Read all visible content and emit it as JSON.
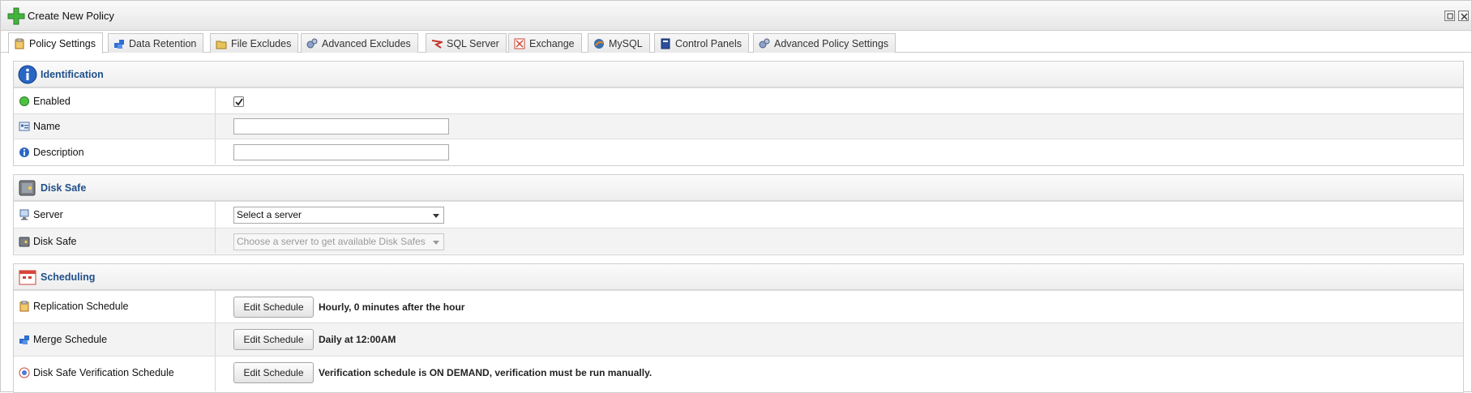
{
  "window": {
    "title": "Create New Policy",
    "maximize_icon": "maximize-icon",
    "close_icon": "close-icon"
  },
  "tabs": [
    {
      "label": "Policy Settings",
      "icon": "clipboard-icon",
      "active": true
    },
    {
      "label": "Data Retention",
      "icon": "stack-icon",
      "active": false
    },
    {
      "label": "File Excludes",
      "icon": "folder-icon",
      "active": false
    },
    {
      "label": "Advanced Excludes",
      "icon": "gears-icon",
      "active": false
    },
    {
      "label": "SQL Server",
      "icon": "sql-server-icon",
      "active": false
    },
    {
      "label": "Exchange",
      "icon": "exchange-icon",
      "active": false
    },
    {
      "label": "MySQL",
      "icon": "mysql-icon",
      "active": false
    },
    {
      "label": "Control Panels",
      "icon": "book-icon",
      "active": false
    },
    {
      "label": "Advanced Policy Settings",
      "icon": "gears-icon",
      "active": false
    }
  ],
  "identification": {
    "title": "Identification",
    "enabled_label": "Enabled",
    "enabled_checked": true,
    "name_label": "Name",
    "name_value": "",
    "description_label": "Description",
    "description_value": ""
  },
  "disk_safe": {
    "title": "Disk Safe",
    "server_label": "Server",
    "server_value": "Select a server",
    "disk_safe_label": "Disk Safe",
    "disk_safe_value": "Choose a server to get available Disk Safes"
  },
  "scheduling": {
    "title": "Scheduling",
    "replication_label": "Replication Schedule",
    "replication_button": "Edit Schedule",
    "replication_value": "Hourly, 0 minutes after the hour",
    "merge_label": "Merge Schedule",
    "merge_button": "Edit Schedule",
    "merge_value": "Daily at 12:00AM",
    "verification_label": "Disk Safe Verification Schedule",
    "verification_button": "Edit Schedule",
    "verification_value": "Verification schedule is ON DEMAND, verification must be run manually."
  },
  "colors": {
    "section_title": "#1f4f8a",
    "row_alt": "#f3f3f3",
    "border": "#cfcfcf"
  }
}
